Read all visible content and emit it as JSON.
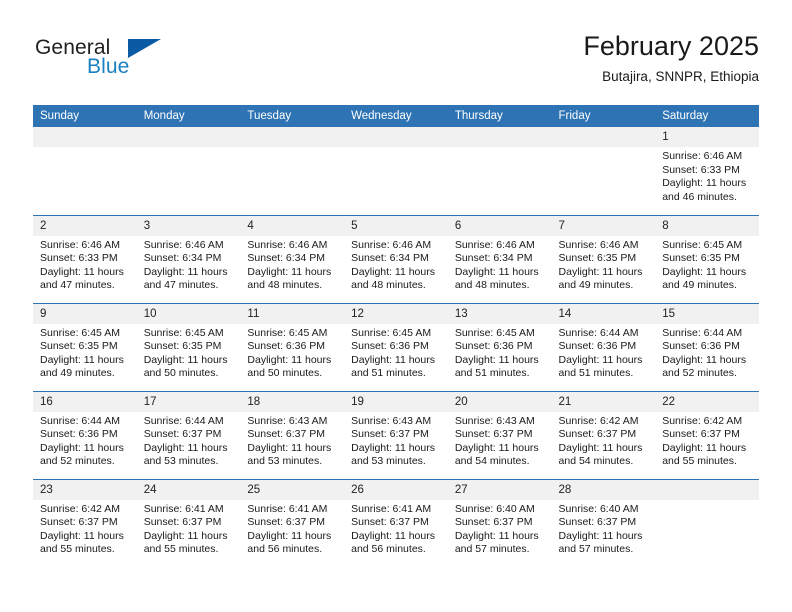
{
  "brand": {
    "name_part1": "General",
    "name_part2": "Blue",
    "accent_color": "#1b7fc4",
    "triangle_color": "#0a5ba3",
    "triangle_icon": "triangle-icon"
  },
  "header": {
    "title": "February 2025",
    "subtitle": "Butajira, SNNPR, Ethiopia"
  },
  "theme": {
    "header_band": "#2e74b5",
    "daynum_strip": "#f1f1f1",
    "row_divider": "#2e74b5"
  },
  "weekdays": [
    "Sunday",
    "Monday",
    "Tuesday",
    "Wednesday",
    "Thursday",
    "Friday",
    "Saturday"
  ],
  "weeks": [
    [
      {
        "day": "",
        "sunrise": "",
        "sunset": "",
        "daylight": "",
        "empty": true
      },
      {
        "day": "",
        "sunrise": "",
        "sunset": "",
        "daylight": "",
        "empty": true
      },
      {
        "day": "",
        "sunrise": "",
        "sunset": "",
        "daylight": "",
        "empty": true
      },
      {
        "day": "",
        "sunrise": "",
        "sunset": "",
        "daylight": "",
        "empty": true
      },
      {
        "day": "",
        "sunrise": "",
        "sunset": "",
        "daylight": "",
        "empty": true
      },
      {
        "day": "",
        "sunrise": "",
        "sunset": "",
        "daylight": "",
        "empty": true
      },
      {
        "day": "1",
        "sunrise": "Sunrise: 6:46 AM",
        "sunset": "Sunset: 6:33 PM",
        "daylight": "Daylight: 11 hours and 46 minutes.",
        "empty": false
      }
    ],
    [
      {
        "day": "2",
        "sunrise": "Sunrise: 6:46 AM",
        "sunset": "Sunset: 6:33 PM",
        "daylight": "Daylight: 11 hours and 47 minutes.",
        "empty": false
      },
      {
        "day": "3",
        "sunrise": "Sunrise: 6:46 AM",
        "sunset": "Sunset: 6:34 PM",
        "daylight": "Daylight: 11 hours and 47 minutes.",
        "empty": false
      },
      {
        "day": "4",
        "sunrise": "Sunrise: 6:46 AM",
        "sunset": "Sunset: 6:34 PM",
        "daylight": "Daylight: 11 hours and 48 minutes.",
        "empty": false
      },
      {
        "day": "5",
        "sunrise": "Sunrise: 6:46 AM",
        "sunset": "Sunset: 6:34 PM",
        "daylight": "Daylight: 11 hours and 48 minutes.",
        "empty": false
      },
      {
        "day": "6",
        "sunrise": "Sunrise: 6:46 AM",
        "sunset": "Sunset: 6:34 PM",
        "daylight": "Daylight: 11 hours and 48 minutes.",
        "empty": false
      },
      {
        "day": "7",
        "sunrise": "Sunrise: 6:46 AM",
        "sunset": "Sunset: 6:35 PM",
        "daylight": "Daylight: 11 hours and 49 minutes.",
        "empty": false
      },
      {
        "day": "8",
        "sunrise": "Sunrise: 6:45 AM",
        "sunset": "Sunset: 6:35 PM",
        "daylight": "Daylight: 11 hours and 49 minutes.",
        "empty": false
      }
    ],
    [
      {
        "day": "9",
        "sunrise": "Sunrise: 6:45 AM",
        "sunset": "Sunset: 6:35 PM",
        "daylight": "Daylight: 11 hours and 49 minutes.",
        "empty": false
      },
      {
        "day": "10",
        "sunrise": "Sunrise: 6:45 AM",
        "sunset": "Sunset: 6:35 PM",
        "daylight": "Daylight: 11 hours and 50 minutes.",
        "empty": false
      },
      {
        "day": "11",
        "sunrise": "Sunrise: 6:45 AM",
        "sunset": "Sunset: 6:36 PM",
        "daylight": "Daylight: 11 hours and 50 minutes.",
        "empty": false
      },
      {
        "day": "12",
        "sunrise": "Sunrise: 6:45 AM",
        "sunset": "Sunset: 6:36 PM",
        "daylight": "Daylight: 11 hours and 51 minutes.",
        "empty": false
      },
      {
        "day": "13",
        "sunrise": "Sunrise: 6:45 AM",
        "sunset": "Sunset: 6:36 PM",
        "daylight": "Daylight: 11 hours and 51 minutes.",
        "empty": false
      },
      {
        "day": "14",
        "sunrise": "Sunrise: 6:44 AM",
        "sunset": "Sunset: 6:36 PM",
        "daylight": "Daylight: 11 hours and 51 minutes.",
        "empty": false
      },
      {
        "day": "15",
        "sunrise": "Sunrise: 6:44 AM",
        "sunset": "Sunset: 6:36 PM",
        "daylight": "Daylight: 11 hours and 52 minutes.",
        "empty": false
      }
    ],
    [
      {
        "day": "16",
        "sunrise": "Sunrise: 6:44 AM",
        "sunset": "Sunset: 6:36 PM",
        "daylight": "Daylight: 11 hours and 52 minutes.",
        "empty": false
      },
      {
        "day": "17",
        "sunrise": "Sunrise: 6:44 AM",
        "sunset": "Sunset: 6:37 PM",
        "daylight": "Daylight: 11 hours and 53 minutes.",
        "empty": false
      },
      {
        "day": "18",
        "sunrise": "Sunrise: 6:43 AM",
        "sunset": "Sunset: 6:37 PM",
        "daylight": "Daylight: 11 hours and 53 minutes.",
        "empty": false
      },
      {
        "day": "19",
        "sunrise": "Sunrise: 6:43 AM",
        "sunset": "Sunset: 6:37 PM",
        "daylight": "Daylight: 11 hours and 53 minutes.",
        "empty": false
      },
      {
        "day": "20",
        "sunrise": "Sunrise: 6:43 AM",
        "sunset": "Sunset: 6:37 PM",
        "daylight": "Daylight: 11 hours and 54 minutes.",
        "empty": false
      },
      {
        "day": "21",
        "sunrise": "Sunrise: 6:42 AM",
        "sunset": "Sunset: 6:37 PM",
        "daylight": "Daylight: 11 hours and 54 minutes.",
        "empty": false
      },
      {
        "day": "22",
        "sunrise": "Sunrise: 6:42 AM",
        "sunset": "Sunset: 6:37 PM",
        "daylight": "Daylight: 11 hours and 55 minutes.",
        "empty": false
      }
    ],
    [
      {
        "day": "23",
        "sunrise": "Sunrise: 6:42 AM",
        "sunset": "Sunset: 6:37 PM",
        "daylight": "Daylight: 11 hours and 55 minutes.",
        "empty": false
      },
      {
        "day": "24",
        "sunrise": "Sunrise: 6:41 AM",
        "sunset": "Sunset: 6:37 PM",
        "daylight": "Daylight: 11 hours and 55 minutes.",
        "empty": false
      },
      {
        "day": "25",
        "sunrise": "Sunrise: 6:41 AM",
        "sunset": "Sunset: 6:37 PM",
        "daylight": "Daylight: 11 hours and 56 minutes.",
        "empty": false
      },
      {
        "day": "26",
        "sunrise": "Sunrise: 6:41 AM",
        "sunset": "Sunset: 6:37 PM",
        "daylight": "Daylight: 11 hours and 56 minutes.",
        "empty": false
      },
      {
        "day": "27",
        "sunrise": "Sunrise: 6:40 AM",
        "sunset": "Sunset: 6:37 PM",
        "daylight": "Daylight: 11 hours and 57 minutes.",
        "empty": false
      },
      {
        "day": "28",
        "sunrise": "Sunrise: 6:40 AM",
        "sunset": "Sunset: 6:37 PM",
        "daylight": "Daylight: 11 hours and 57 minutes.",
        "empty": false
      },
      {
        "day": "",
        "sunrise": "",
        "sunset": "",
        "daylight": "",
        "empty": true
      }
    ]
  ]
}
